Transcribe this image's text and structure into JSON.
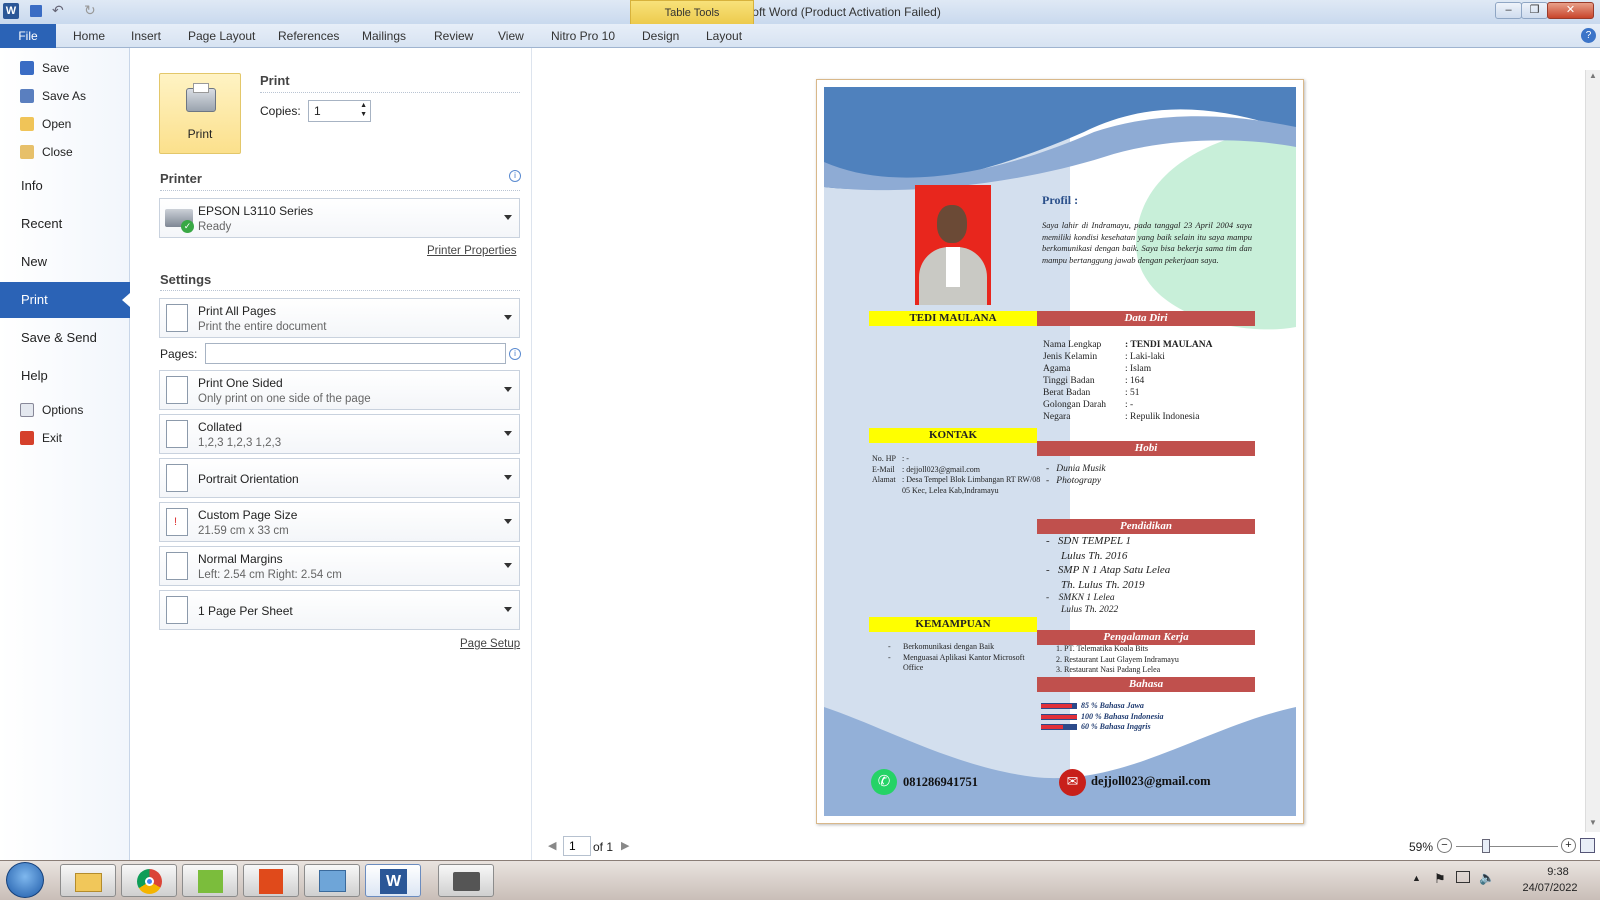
{
  "window": {
    "title": "CV TEDI  -  Microsoft Word (Product Activation Failed)",
    "context_tab_group": "Table Tools",
    "controls": {
      "minimize": "–",
      "maximize": "❐",
      "close": "✕"
    }
  },
  "ribbon": {
    "file_tab": "File",
    "tabs": [
      "Home",
      "Insert",
      "Page Layout",
      "References",
      "Mailings",
      "Review",
      "View",
      "Nitro Pro 10",
      "Design",
      "Layout"
    ]
  },
  "backstage_nav": {
    "items_small": [
      {
        "label": "Save",
        "icon": "save-icon"
      },
      {
        "label": "Save As",
        "icon": "save-as-icon"
      },
      {
        "label": "Open",
        "icon": "open-folder-icon"
      },
      {
        "label": "Close",
        "icon": "close-folder-icon"
      }
    ],
    "items_big": [
      "Info",
      "Recent",
      "New",
      "Print",
      "Save & Send",
      "Help"
    ],
    "items_bottom": [
      {
        "label": "Options",
        "icon": "options-icon"
      },
      {
        "label": "Exit",
        "icon": "exit-icon"
      }
    ],
    "selected": "Print"
  },
  "print_panel": {
    "print_button": "Print",
    "heading": "Print",
    "copies_label": "Copies:",
    "copies_value": "1",
    "printer_heading": "Printer",
    "printer_name": "EPSON L3110 Series",
    "printer_status": "Ready",
    "printer_properties": "Printer Properties",
    "settings_heading": "Settings",
    "pages_label": "Pages:",
    "pages_value": "",
    "settings": [
      {
        "line1": "Print All Pages",
        "line2": "Print the entire document"
      },
      {
        "line1": "Print One Sided",
        "line2": "Only print on one side of the page"
      },
      {
        "line1": "Collated",
        "line2": "1,2,3    1,2,3    1,2,3"
      },
      {
        "line1": "Portrait Orientation",
        "line2": ""
      },
      {
        "line1": "Custom Page Size",
        "line2": "21.59 cm x 33 cm"
      },
      {
        "line1": "Normal Margins",
        "line2": "Left:  2.54 cm    Right:  2.54 cm"
      },
      {
        "line1": "1 Page Per Sheet",
        "line2": ""
      }
    ],
    "page_setup": "Page Setup"
  },
  "cv": {
    "name_bar": "TEDI MAULANA",
    "profil_title": "Profil :",
    "profil_text": "Saya lahir di Indramayu, pada tanggal 23 April 2004 saya memiliki kondisi kesehatan yang baik selain itu saya mampu berkomunikasi dengan baik. Saya bisa bekerja sama tim dan mampu bertanggung jawab dengan pekerjaan saya.",
    "data_diri_title": "Data Diri",
    "data_diri": [
      {
        "k": "Nama Lengkap",
        "v": ": TENDI MAULANA"
      },
      {
        "k": "Jenis Kelamin",
        "v": ": Laki-laki"
      },
      {
        "k": "Agama",
        "v": ": Islam"
      },
      {
        "k": "Tinggi Badan",
        "v": ": 164"
      },
      {
        "k": "Berat Badan",
        "v": ": 51"
      },
      {
        "k": "Golongan Darah",
        "v": ": -"
      },
      {
        "k": "Negara",
        "v": ": Repulik Indonesia"
      }
    ],
    "kontak_title": "KONTAK",
    "kontak": [
      {
        "k": "No. HP",
        "v": ": -"
      },
      {
        "k": "E-Mail",
        "v": ": dejjoll023@gmail.com"
      },
      {
        "k": "Alamat",
        "v": ": Desa Tempel Blok Limbangan RT RW/08 05 Kec, Lelea Kab,Indramayu"
      }
    ],
    "hobi_title": "Hobi",
    "hobi": [
      "Dunia Musik",
      "Photograpy"
    ],
    "pendidikan_title": "Pendidikan",
    "pendidikan": [
      {
        "school": "SDN TEMPEL 1",
        "year": "Lulus Th. 2016"
      },
      {
        "school": "SMP N 1 Atap Satu Lelea",
        "year": "Th. Lulus Th. 2019"
      },
      {
        "school": "SMKN 1 Lelea",
        "year": "Lulus Th. 2022"
      }
    ],
    "kemampuan_title": "KEMAMPUAN",
    "kemampuan": [
      "Berkomunikasi dengan Baik",
      "Menguasai Aplikasi Kantor Microsoft Office"
    ],
    "pengalaman_title": "Pengalaman Kerja",
    "pengalaman": [
      "1.   PT. Telematika Koala Bits",
      "2.   Restaurant Laut Glayem Indramayu",
      "3.   Restaurant Nasi Padang Lelea"
    ],
    "bahasa_title": "Bahasa",
    "bahasa": [
      {
        "label": "85 %   Bahasa Jawa",
        "level": 0.85
      },
      {
        "label": "100 % Bahasa Indonesia",
        "level": 1.0
      },
      {
        "label": "60 %   Bahasa Inggris",
        "level": 0.6
      }
    ],
    "footer_phone": "081286941751",
    "footer_email": "dejjoll023@gmail.com"
  },
  "preview_nav": {
    "page_value": "1",
    "of_label": "of 1"
  },
  "zoom": {
    "value": "59%",
    "level": 0.59
  },
  "taskbar": {
    "time": "9:38",
    "date": "24/07/2022"
  },
  "colors": {
    "file_blue": "#2b63b6",
    "cv_blue": "#4f81bd",
    "cv_red": "#c0504d",
    "cv_yellow": "#ffff00",
    "photo_red": "#e8261d"
  }
}
